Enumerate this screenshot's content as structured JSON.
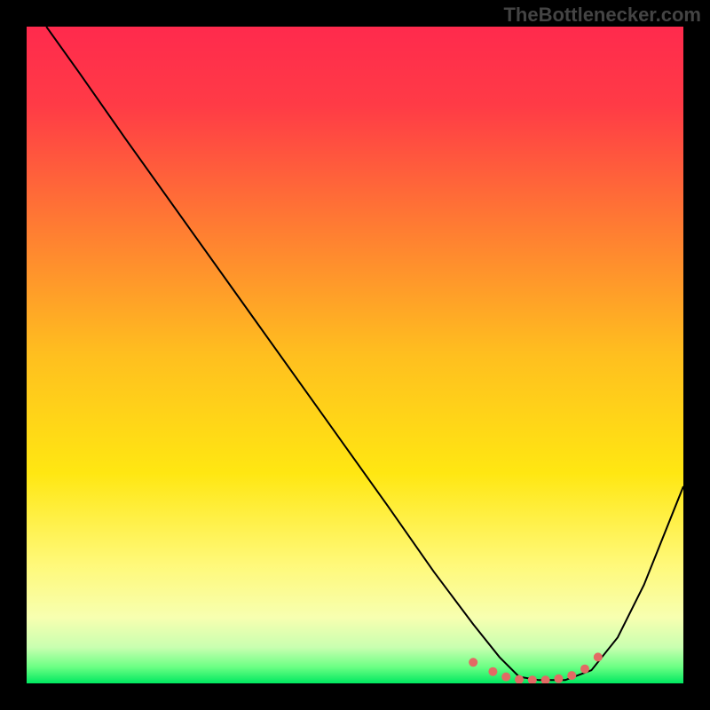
{
  "watermark": "TheBottlenecker.com",
  "chart_data": {
    "type": "line",
    "title": "",
    "xlabel": "",
    "ylabel": "",
    "xlim": [
      0,
      100
    ],
    "ylim": [
      0,
      100
    ],
    "background_gradient": {
      "stops": [
        {
          "offset": 0.0,
          "color": "#ff2a4d"
        },
        {
          "offset": 0.12,
          "color": "#ff3b46"
        },
        {
          "offset": 0.3,
          "color": "#ff7a33"
        },
        {
          "offset": 0.5,
          "color": "#ffbf1f"
        },
        {
          "offset": 0.68,
          "color": "#ffe712"
        },
        {
          "offset": 0.82,
          "color": "#fff97a"
        },
        {
          "offset": 0.9,
          "color": "#f7ffb0"
        },
        {
          "offset": 0.945,
          "color": "#c9ffb0"
        },
        {
          "offset": 0.975,
          "color": "#6cff84"
        },
        {
          "offset": 1.0,
          "color": "#00e860"
        }
      ]
    },
    "series": [
      {
        "name": "bottleneck-curve",
        "color": "#000000",
        "x": [
          3,
          8,
          15,
          25,
          35,
          45,
          55,
          62,
          68,
          72,
          75,
          78,
          82,
          86,
          90,
          94,
          100
        ],
        "y": [
          100,
          93,
          83,
          69,
          55,
          41,
          27,
          17,
          9,
          4,
          1,
          0.5,
          0.5,
          2,
          7,
          15,
          30
        ]
      }
    ],
    "markers": {
      "name": "optimal-range",
      "color": "#e26a64",
      "radius": 5,
      "x": [
        68,
        71,
        73,
        75,
        77,
        79,
        81,
        83,
        85,
        87
      ],
      "y": [
        3.2,
        1.8,
        1.0,
        0.6,
        0.5,
        0.5,
        0.7,
        1.2,
        2.2,
        4.0
      ]
    }
  }
}
